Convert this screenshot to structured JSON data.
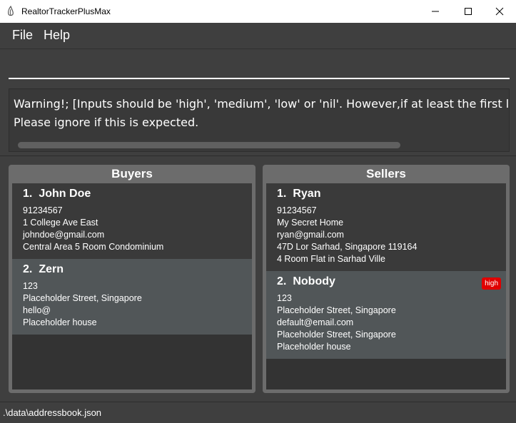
{
  "window": {
    "title": "RealtorTrackerPlusMax"
  },
  "menu": {
    "items": [
      "File",
      "Help"
    ]
  },
  "command": {
    "value": ""
  },
  "result": {
    "lines": [
      "Warning!; [Inputs should be 'high', 'medium', 'low' or 'nil'. However,if at least the first letter is vali",
      "Please ignore if this is expected."
    ]
  },
  "buyers": {
    "header": "Buyers",
    "cards": [
      {
        "index": "1.",
        "name": "John Doe",
        "phone": "91234567",
        "address": "1 College Ave East",
        "email": "johndoe@gmail.com",
        "house": "Central Area 5 Room Condominium"
      },
      {
        "index": "2.",
        "name": "Zern",
        "phone": "123",
        "address": "Placeholder Street, Singapore",
        "email": "hello@",
        "house": "Placeholder house"
      }
    ]
  },
  "sellers": {
    "header": "Sellers",
    "cards": [
      {
        "index": "1.",
        "name": "Ryan",
        "phone": "91234567",
        "address": "My Secret Home",
        "email": "ryan@gmail.com",
        "house_address": "47D Lor Sarhad, Singapore 119164",
        "house": "4 Room Flat in Sarhad Ville"
      },
      {
        "index": "2.",
        "name": "Nobody",
        "tag": "high",
        "phone": "123",
        "address": "Placeholder Street, Singapore",
        "email": "default@email.com",
        "house_address": "Placeholder Street, Singapore",
        "house": "Placeholder house"
      }
    ]
  },
  "status": {
    "path": ".\\data\\addressbook.json"
  },
  "colors": {
    "tag_high": "#e00000",
    "selected_card": "#515658",
    "panel_frame": "#6c6c6c"
  }
}
